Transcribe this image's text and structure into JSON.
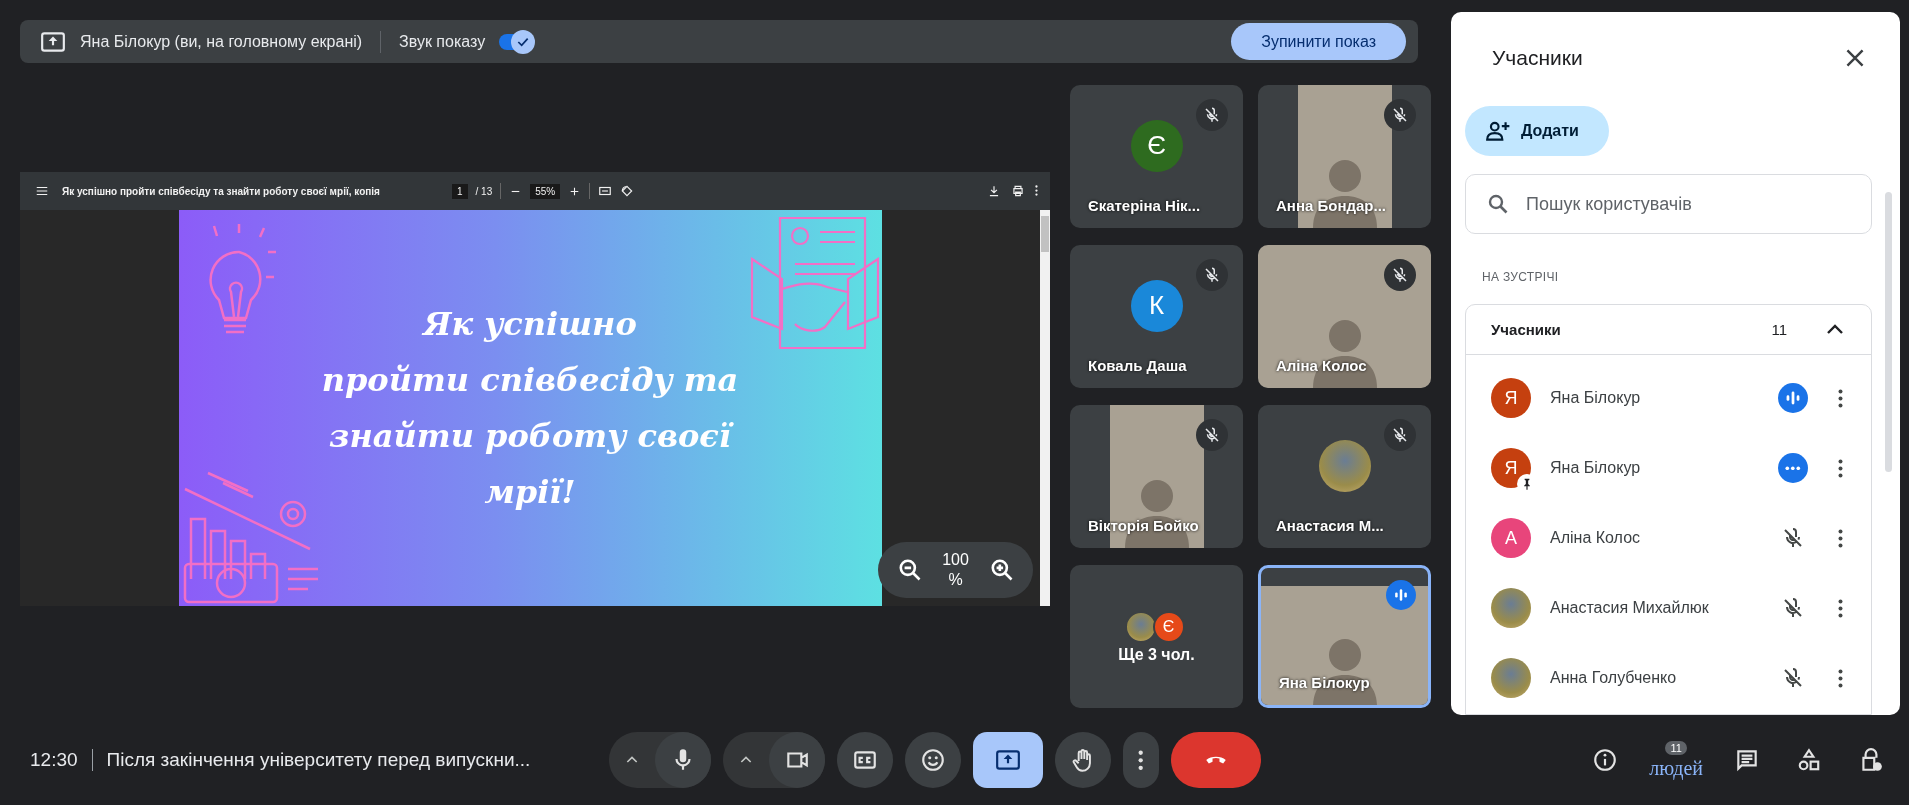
{
  "share_bar": {
    "presenter": "Яна Білокур (ви, на головному екрані)",
    "sound_label": "Звук показу",
    "sound_on": true,
    "stop_button": "Зупинити показ"
  },
  "pdf_viewer": {
    "title": "Як успішно пройти співбесіду та знайти роботу своєї мрії, копія",
    "page": "1",
    "page_total": "/ 13",
    "zoom": "55%",
    "slide_lines": [
      "Як успішно",
      "пройти співбесіду та",
      "знайти роботу своєї",
      "мрії!"
    ],
    "overlay_zoom": "100 %"
  },
  "tiles": [
    {
      "name": "Єкатеріна Нік...",
      "kind": "avatar",
      "letter": "Є",
      "color": "#2e6b1f",
      "muted": true,
      "speaking": false,
      "active": false
    },
    {
      "name": "Анна Бондар...",
      "kind": "portrait_video",
      "muted": true,
      "speaking": false,
      "active": false
    },
    {
      "name": "Коваль Даша",
      "kind": "avatar",
      "letter": "К",
      "color": "#1a88d9",
      "muted": true,
      "speaking": false,
      "active": false
    },
    {
      "name": "Аліна Колос",
      "kind": "video",
      "muted": true,
      "speaking": false,
      "active": false
    },
    {
      "name": "Вікторія Бойко",
      "kind": "portrait_video",
      "muted": true,
      "speaking": false,
      "active": false
    },
    {
      "name": "Анастасия М...",
      "kind": "photo",
      "muted": true,
      "speaking": false,
      "active": false
    },
    {
      "name": "Ще 3 чол.",
      "kind": "more",
      "muted": false,
      "speaking": false,
      "active": false,
      "avatars": [
        {
          "kind": "photo"
        },
        {
          "kind": "letter",
          "letter": "Є",
          "color": "#e64a19"
        }
      ]
    },
    {
      "name": "Яна Білокур",
      "kind": "video",
      "muted": false,
      "speaking": true,
      "active": true
    }
  ],
  "panel": {
    "title": "Учасники",
    "add_button": "Додати",
    "search_placeholder": "Пошук користувачів",
    "section": "НА ЗУСТРІЧІ",
    "group": {
      "label": "Учасники",
      "count": "11",
      "expanded": true
    },
    "people": [
      {
        "name": "Яна Білокур",
        "kind": "letter",
        "letter": "Я",
        "color": "#c5400f",
        "pinned": false,
        "speaking": true,
        "muted": false,
        "audio_dots": false
      },
      {
        "name": "Яна Білокур",
        "kind": "letter",
        "letter": "Я",
        "color": "#c5400f",
        "pinned": true,
        "speaking": false,
        "muted": false,
        "audio_dots": true
      },
      {
        "name": "Аліна Колос",
        "kind": "letter",
        "letter": "А",
        "color": "#e8457b",
        "pinned": false,
        "speaking": false,
        "muted": true,
        "audio_dots": false
      },
      {
        "name": "Анастасия Михайлюк",
        "kind": "photo",
        "pinned": false,
        "speaking": false,
        "muted": true,
        "audio_dots": false
      },
      {
        "name": "Анна Голубченко",
        "kind": "photo",
        "pinned": false,
        "speaking": false,
        "muted": true,
        "audio_dots": false
      }
    ]
  },
  "bottom_bar": {
    "clock": "12:30",
    "meeting_title": "Після закінчення університету перед випускни...",
    "controls": [
      {
        "kind": "mic",
        "caret": true,
        "selected": false
      },
      {
        "kind": "camera",
        "caret": true,
        "selected": false
      },
      {
        "kind": "captions",
        "caret": false,
        "selected": false
      },
      {
        "kind": "emoji",
        "caret": false,
        "selected": false
      },
      {
        "kind": "present",
        "caret": false,
        "selected": true
      },
      {
        "kind": "hand",
        "caret": false,
        "selected": false
      },
      {
        "kind": "more",
        "caret": false,
        "selected": false
      },
      {
        "kind": "end_call",
        "caret": false,
        "selected": false
      }
    ],
    "tools": [
      {
        "kind": "info"
      },
      {
        "kind": "people",
        "badge": "11",
        "label": "людей"
      },
      {
        "kind": "chat"
      },
      {
        "kind": "activities"
      },
      {
        "kind": "lock"
      }
    ]
  }
}
